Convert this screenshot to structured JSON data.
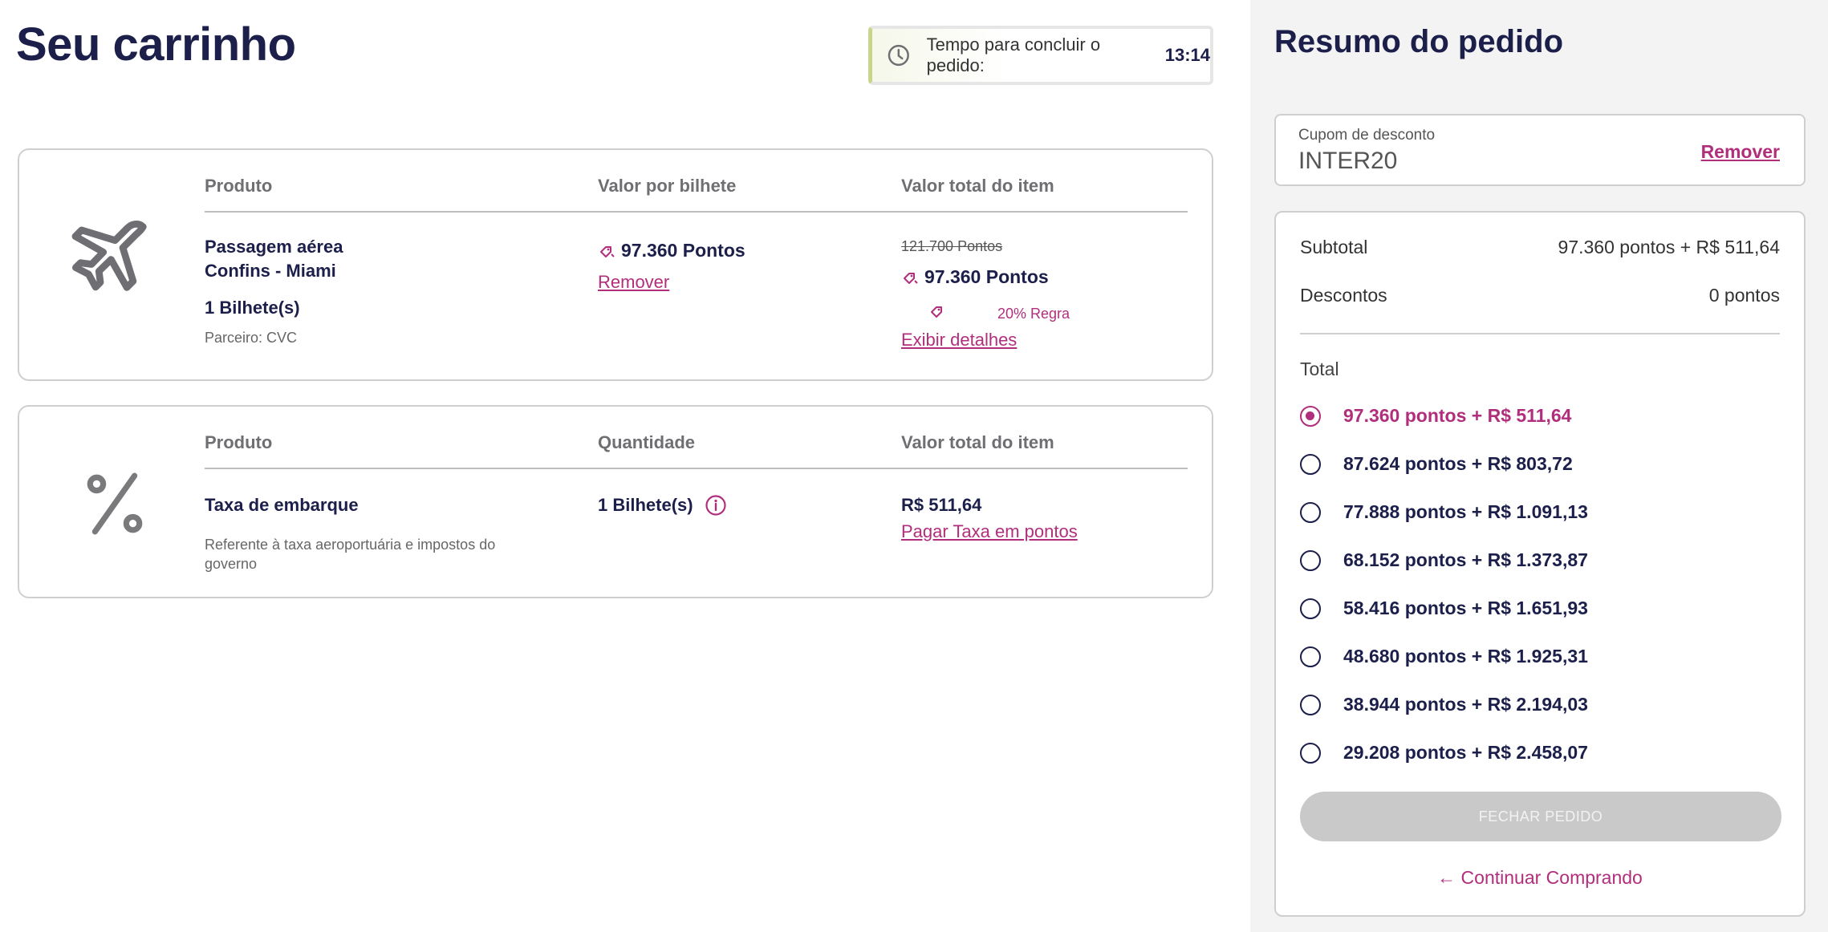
{
  "cart": {
    "title": "Seu carrinho",
    "timer": {
      "label": "Tempo para concluir o pedido:",
      "value": "13:14"
    },
    "items": [
      {
        "headers": [
          "Produto",
          "Valor por bilhete",
          "Valor total do item"
        ],
        "icon": "airplane-icon",
        "name_line1": "Passagem aérea",
        "name_line2": "Confins - Miami",
        "tickets": "1 Bilhete(s)",
        "partner": "Parceiro: CVC",
        "price_per_ticket": "97.360 Pontos",
        "remove_label": "Remover",
        "old_total": "121.700 Pontos",
        "total": "97.360 Pontos",
        "rule": "20% Regra",
        "details_label": "Exibir detalhes"
      },
      {
        "headers": [
          "Produto",
          "Quantidade",
          "Valor total do item"
        ],
        "icon": "percent-icon",
        "name": "Taxa de embarque",
        "description": "Referente à taxa aeroportuária e impostos do governo",
        "quantity": "1 Bilhete(s)",
        "total": "R$ 511,64",
        "pay_points_label": "Pagar Taxa em pontos"
      }
    ]
  },
  "summary": {
    "title": "Resumo do pedido",
    "coupon": {
      "label": "Cupom de desconto",
      "value": "INTER20",
      "remove_label": "Remover"
    },
    "subtotal_label": "Subtotal",
    "subtotal_value": "97.360 pontos + R$ 511,64",
    "discounts_label": "Descontos",
    "discounts_value": "0 pontos",
    "total_label": "Total",
    "options": [
      {
        "label": "97.360 pontos + R$ 511,64",
        "selected": true
      },
      {
        "label": "87.624 pontos + R$ 803,72",
        "selected": false
      },
      {
        "label": "77.888 pontos + R$ 1.091,13",
        "selected": false
      },
      {
        "label": "68.152 pontos + R$ 1.373,87",
        "selected": false
      },
      {
        "label": "58.416 pontos + R$ 1.651,93",
        "selected": false
      },
      {
        "label": "48.680 pontos + R$ 1.925,31",
        "selected": false
      },
      {
        "label": "38.944 pontos + R$ 2.194,03",
        "selected": false
      },
      {
        "label": "29.208 pontos + R$ 2.458,07",
        "selected": false
      }
    ],
    "close_button": "FECHAR PEDIDO",
    "continue_label": "Continuar Comprando"
  },
  "colors": {
    "brand_navy": "#1b1f4a",
    "accent_pink": "#b12e7c",
    "timer_accent": "#c8d58a"
  }
}
